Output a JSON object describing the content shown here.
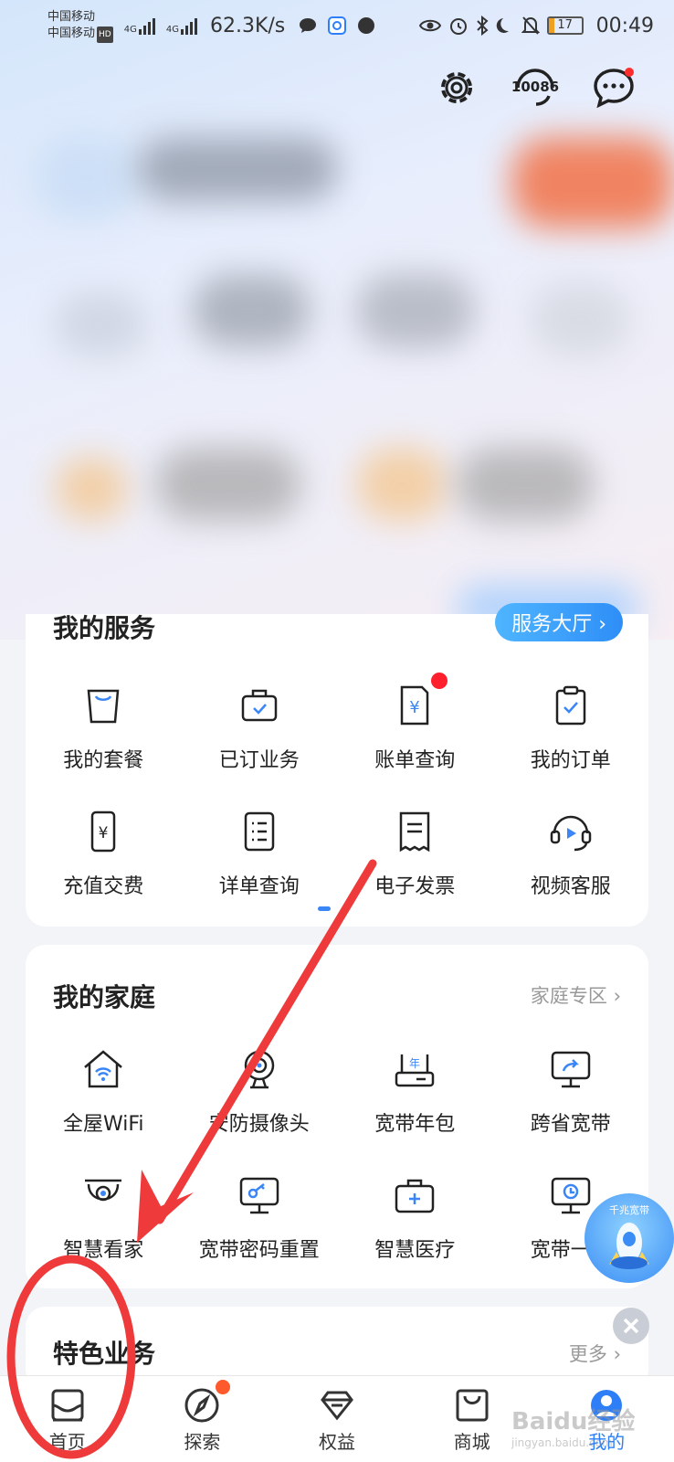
{
  "status_bar": {
    "carrier_1": "中国移动",
    "carrier_2": "中国移动",
    "hd": "HD",
    "network_1": "4G",
    "network_2": "4G",
    "speed": "62.3K/s",
    "battery": "17",
    "time": "00:49"
  },
  "header": {
    "hotline": "10086"
  },
  "services": {
    "title": "我的服务",
    "hall_button": "服务大厅 ›",
    "items": [
      {
        "label": "我的套餐",
        "icon": "shopping-bag-icon"
      },
      {
        "label": "已订业务",
        "icon": "briefcase-check-icon"
      },
      {
        "label": "账单查询",
        "icon": "bill-yuan-icon",
        "badge": true
      },
      {
        "label": "我的订单",
        "icon": "clipboard-check-icon"
      },
      {
        "label": "充值交费",
        "icon": "phone-yuan-icon"
      },
      {
        "label": "详单查询",
        "icon": "list-document-icon"
      },
      {
        "label": "电子发票",
        "icon": "receipt-icon"
      },
      {
        "label": "视频客服",
        "icon": "headset-video-icon"
      }
    ]
  },
  "family": {
    "title": "我的家庭",
    "link": "家庭专区 ›",
    "items": [
      {
        "label": "全屋WiFi",
        "icon": "home-wifi-icon"
      },
      {
        "label": "安防摄像头",
        "icon": "camera-icon"
      },
      {
        "label": "宽带年包",
        "icon": "router-year-icon"
      },
      {
        "label": "跨省宽带",
        "icon": "monitor-share-icon"
      },
      {
        "label": "智慧看家",
        "icon": "dome-camera-icon"
      },
      {
        "label": "宽带密码重置",
        "icon": "monitor-key-icon"
      },
      {
        "label": "智慧医疗",
        "icon": "medical-kit-icon"
      },
      {
        "label": "宽带一键",
        "icon": "monitor-clock-icon"
      }
    ]
  },
  "next_section": {
    "title": "特色业务",
    "link": "更多 ›"
  },
  "float_ad": {
    "text": "千兆宽带"
  },
  "bottom_nav": [
    {
      "label": "首页",
      "icon": "home-icon"
    },
    {
      "label": "探索",
      "icon": "compass-icon",
      "dot": true
    },
    {
      "label": "权益",
      "icon": "diamond-icon"
    },
    {
      "label": "商城",
      "icon": "shopping-bag-icon"
    },
    {
      "label": "我的",
      "icon": "profile-icon",
      "active": true
    }
  ],
  "watermark": {
    "brand": "Baidu经验",
    "url": "jingyan.baidu.com"
  },
  "colors": {
    "accent": "#2e7ff7",
    "badge": "#ff1f2d",
    "annotation": "#ee3a3a"
  }
}
